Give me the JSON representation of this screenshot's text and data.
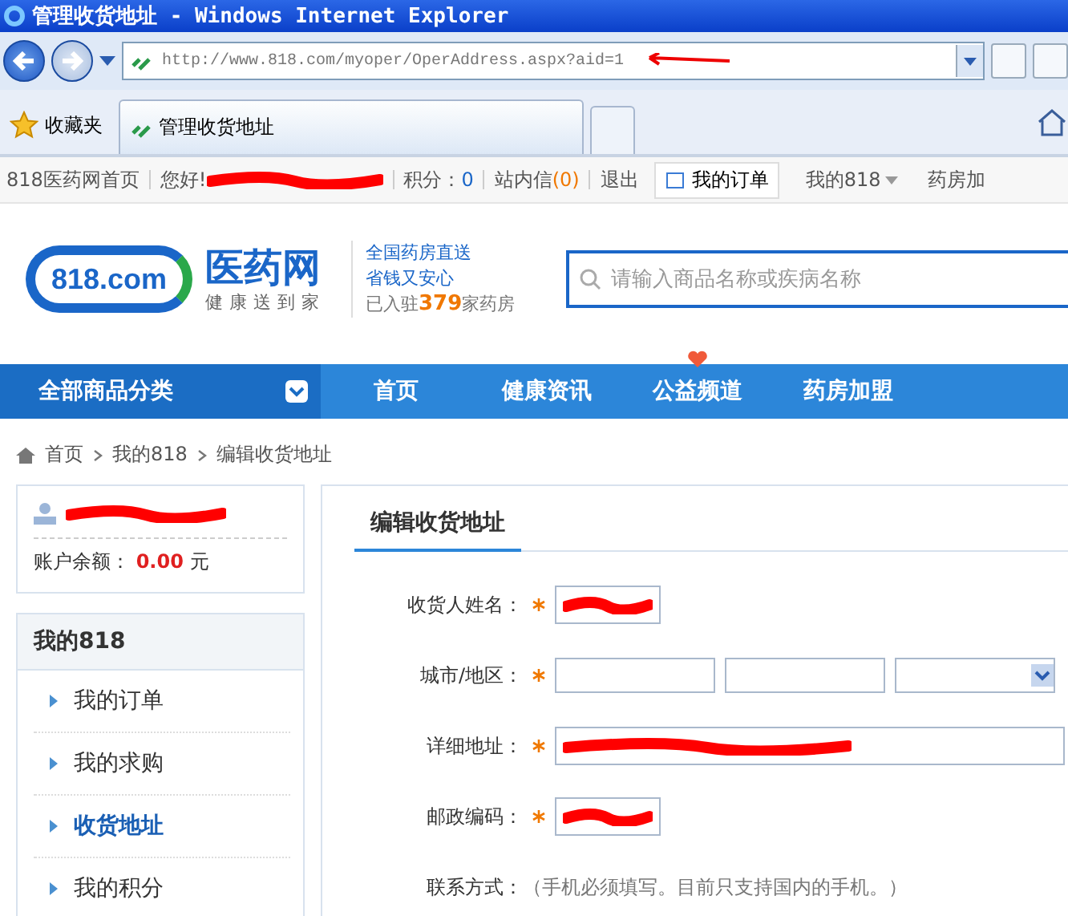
{
  "window": {
    "title": "管理收货地址 - Windows Internet Explorer"
  },
  "browser": {
    "address": "http://www.818.com/myoper/OperAddress.aspx?aid=1",
    "favorites": "收藏夹",
    "tab_title": "管理收货地址"
  },
  "top_bar": {
    "items": [
      {
        "label": "818医药网首页"
      },
      {
        "label": "您好!"
      },
      {
        "label": "积分：",
        "count": "0",
        "kind": "points"
      },
      {
        "label": "站内信",
        "count": "(0)",
        "kind": "messages"
      },
      {
        "label": "退出"
      }
    ],
    "my_orders": "我的订单",
    "my_818": "我的818",
    "pharmacy_join": "药房加"
  },
  "header": {
    "logo_badge": "818.com",
    "logo_name": "医药网",
    "logo_slogan": "健康送到家",
    "promo_1": "全国药房直送",
    "promo_2": "省钱又安心",
    "promo_3_prefix": "已入驻",
    "promo_3_count": "379",
    "promo_3_suffix": "家药房",
    "search_placeholder": "请输入商品名称或疾病名称"
  },
  "nav": {
    "category": "全部商品分类",
    "items": [
      {
        "label": "首页",
        "hot": false
      },
      {
        "label": "健康资讯",
        "hot": false
      },
      {
        "label": "公益频道",
        "hot": true
      },
      {
        "label": "药房加盟",
        "hot": false
      }
    ]
  },
  "breadcrumb": [
    "首页",
    "我的818",
    "编辑收货地址"
  ],
  "account": {
    "balance_label": "账户余额：",
    "balance": "0.00",
    "unit": "元"
  },
  "menu": {
    "title": "我的818",
    "items": [
      {
        "label": "我的订单",
        "selected": false
      },
      {
        "label": "我的求购",
        "selected": false
      },
      {
        "label": "收货地址",
        "selected": true
      },
      {
        "label": "我的积分",
        "selected": false
      }
    ]
  },
  "form": {
    "title": "编辑收货地址",
    "fields": [
      {
        "kind": "text",
        "label": "收货人姓名：",
        "required": true
      },
      {
        "kind": "region",
        "label": "城市/地区：",
        "required": true
      },
      {
        "kind": "wide",
        "label": "详细地址：",
        "required": true
      },
      {
        "kind": "text",
        "label": "邮政编码：",
        "required": true
      },
      {
        "kind": "hint",
        "label": "联系方式：",
        "hint": "（手机必须填写。目前只支持国内的手机。）",
        "required": false
      }
    ]
  }
}
